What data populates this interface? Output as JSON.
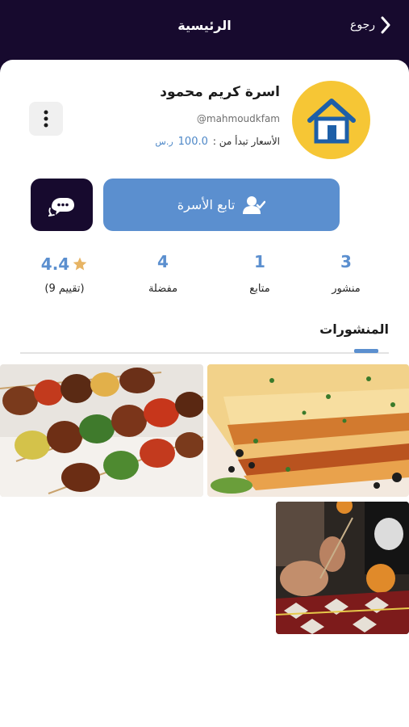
{
  "header": {
    "title": "الرئيسية",
    "back_label": "رجوع"
  },
  "profile": {
    "name": "اسرة كريم محمود",
    "handle": "@mahmoudkfam",
    "price_prefix": "الأسعار تبدأ من :",
    "price_value": "100.0",
    "currency": "ر.س"
  },
  "actions": {
    "follow_label": "تابع الأسرة"
  },
  "stats": {
    "posts": {
      "value": "3",
      "label": "منشور"
    },
    "followers": {
      "value": "1",
      "label": "متابع"
    },
    "favorites": {
      "value": "4",
      "label": "مفضلة"
    },
    "rating": {
      "value": "4.4",
      "label": "(تقييم 9)"
    }
  },
  "posts_section": {
    "title": "المنشورات"
  },
  "colors": {
    "header_bg": "#170a2e",
    "accent_blue": "#5b8fcf",
    "logo_yellow": "#f6c635"
  }
}
